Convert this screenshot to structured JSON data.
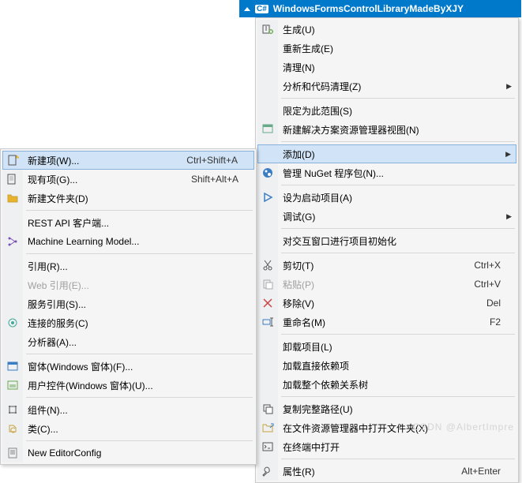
{
  "titlebar": {
    "badge": "C#",
    "project": "WindowsFormsControlLibraryMadeByXJY"
  },
  "right_menu": [
    {
      "label": "生成(U)",
      "icon": "build"
    },
    {
      "label": "重新生成(E)"
    },
    {
      "label": "清理(N)"
    },
    {
      "label": "分析和代码清理(Z)",
      "sub": true
    },
    {
      "sep": true
    },
    {
      "label": "限定为此范围(S)"
    },
    {
      "label": "新建解决方案资源管理器视图(N)",
      "icon": "newview"
    },
    {
      "sep": true
    },
    {
      "label": "添加(D)",
      "sub": true,
      "hl": true
    },
    {
      "label": "管理 NuGet 程序包(N)...",
      "icon": "nuget"
    },
    {
      "sep": true
    },
    {
      "label": "设为启动项目(A)",
      "icon": "startup"
    },
    {
      "label": "调试(G)",
      "sub": true
    },
    {
      "sep": true
    },
    {
      "label": "对交互窗口进行项目初始化"
    },
    {
      "sep": true
    },
    {
      "label": "剪切(T)",
      "shortcut": "Ctrl+X",
      "icon": "cut"
    },
    {
      "label": "粘贴(P)",
      "shortcut": "Ctrl+V",
      "icon": "paste",
      "disabled": true
    },
    {
      "label": "移除(V)",
      "shortcut": "Del",
      "icon": "remove"
    },
    {
      "label": "重命名(M)",
      "shortcut": "F2",
      "icon": "rename"
    },
    {
      "sep": true
    },
    {
      "label": "卸载项目(L)"
    },
    {
      "label": "加载直接依赖项"
    },
    {
      "label": "加载整个依赖关系树"
    },
    {
      "sep": true
    },
    {
      "label": "复制完整路径(U)",
      "icon": "copy"
    },
    {
      "label": "在文件资源管理器中打开文件夹(X)",
      "icon": "folder"
    },
    {
      "label": "在终端中打开",
      "icon": "terminal"
    },
    {
      "sep": true
    },
    {
      "label": "属性(R)",
      "shortcut": "Alt+Enter",
      "icon": "wrench"
    }
  ],
  "left_menu": [
    {
      "label": "新建项(W)...",
      "shortcut": "Ctrl+Shift+A",
      "icon": "newitem",
      "hl": true
    },
    {
      "label": "现有项(G)...",
      "shortcut": "Shift+Alt+A",
      "icon": "existitem"
    },
    {
      "label": "新建文件夹(D)",
      "icon": "newfolder"
    },
    {
      "sep": true
    },
    {
      "label": "REST API 客户端..."
    },
    {
      "label": "Machine Learning Model...",
      "icon": "ml"
    },
    {
      "sep": true
    },
    {
      "label": "引用(R)..."
    },
    {
      "label": "Web 引用(E)...",
      "disabled": true
    },
    {
      "label": "服务引用(S)..."
    },
    {
      "label": "连接的服务(C)",
      "icon": "connected"
    },
    {
      "label": "分析器(A)..."
    },
    {
      "sep": true
    },
    {
      "label": "窗体(Windows 窗体)(F)...",
      "icon": "form"
    },
    {
      "label": "用户控件(Windows 窗体)(U)...",
      "icon": "usercontrol"
    },
    {
      "sep": true
    },
    {
      "label": "组件(N)...",
      "icon": "component"
    },
    {
      "label": "类(C)...",
      "icon": "class"
    },
    {
      "sep": true
    },
    {
      "label": "New EditorConfig",
      "icon": "editorconfig"
    }
  ],
  "watermark": "CSDN @AlbertImpre"
}
